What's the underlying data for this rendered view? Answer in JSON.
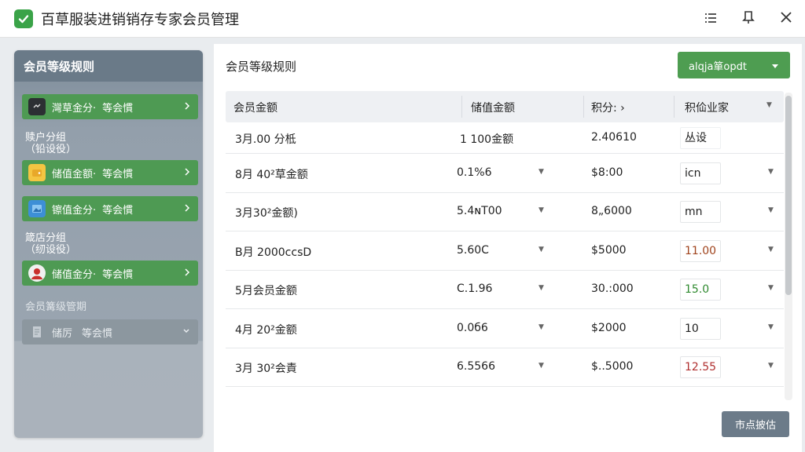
{
  "app": {
    "title": "百草服装进销销存专家会员管理"
  },
  "titlebar_buttons": [
    "menu-icon",
    "pin-icon",
    "close-icon"
  ],
  "sidebar": {
    "header": "会员等级规则",
    "groups": [
      {
        "title": "",
        "items": [
          {
            "icon": "gear-icon",
            "label": "灣草金分·",
            "sub": "等会慣"
          }
        ]
      },
      {
        "title": "赎户分组\n（铅设役）",
        "items": [
          {
            "icon": "wallet-icon",
            "label": "储值金额·",
            "sub": "等会慣"
          },
          {
            "icon": "image-icon",
            "label": "镲值金分·",
            "sub": "等会慣"
          }
        ]
      },
      {
        "title": "箴店分组\n（纫设役）",
        "items": [
          {
            "icon": "avatar-icon",
            "label": "储值金分·",
            "sub": "等会慣"
          }
        ]
      }
    ],
    "footer_title": "会员篝级管期",
    "footer_item": {
      "icon": "document-icon",
      "label": "储厉",
      "sub": "等会慣"
    }
  },
  "main": {
    "title": "会员等级规则",
    "action_button": "alqja箪opdt",
    "export_button": "市点披估",
    "columns": [
      "会员金额",
      "储值金额",
      "积分: ›",
      "积佡业家"
    ]
  },
  "table_rows": [
    {
      "c1": "3月.00 分柢",
      "c2": "1 100金额",
      "c3": "2.40610",
      "c4": "丛设",
      "c4_color": "#222222",
      "dropdowns": false
    },
    {
      "c1": "8月 40²草金额",
      "c2": "0.1%6",
      "c3": "$8:00",
      "c4": "icn",
      "c4_color": "#222222",
      "dropdowns": true
    },
    {
      "c1": "3月30²金额)",
      "c2": "5.4ɴT00",
      "c3": "8„6000",
      "c4": "mn",
      "c4_color": "#222222",
      "dropdowns": true
    },
    {
      "c1": "B月 2000ccsD",
      "c2": "5.60C",
      "c3": "$5000",
      "c4": "11.00",
      "c4_color": "#a0441d",
      "dropdowns": true
    },
    {
      "c1": "5月会员金额",
      "c2": "C.1.96",
      "c3": "30.:000",
      "c4": "15.0",
      "c4_color": "#2f8a2f",
      "dropdowns": true
    },
    {
      "c1": "4月 20²金额",
      "c2": "0.0б6",
      "c3": "$2000",
      "c4": "10",
      "c4_color": "#222222",
      "dropdowns": true
    },
    {
      "c1": "3月 30²会責",
      "c2": "6.5566",
      "c3": "$..5000",
      "c4": "12.55",
      "c4_color": "#b03030",
      "dropdowns": true
    }
  ],
  "colors": {
    "accent_green": "#4e9d51",
    "sidebar_bg": "#8593a0",
    "export_button": "#6c7b89"
  }
}
